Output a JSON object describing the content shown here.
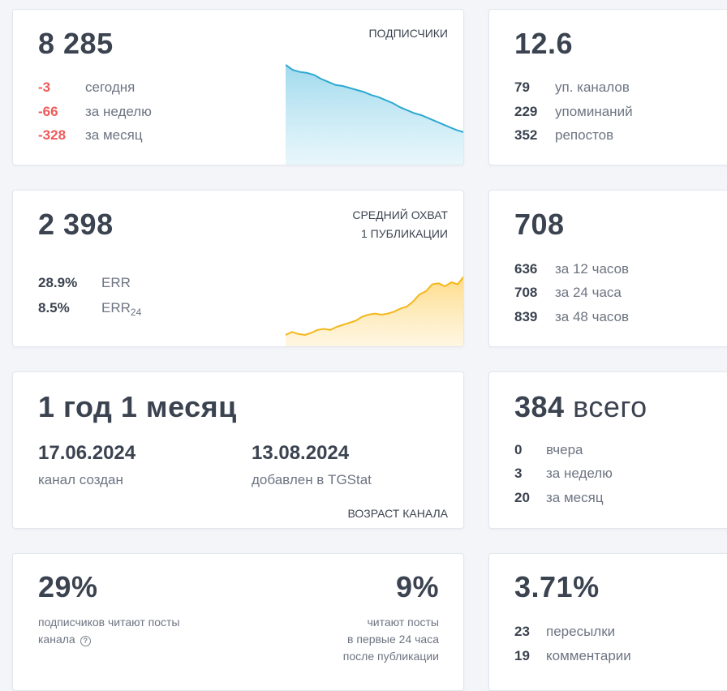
{
  "subscribers": {
    "value": "8 285",
    "caption": "ПОДПИСЧИКИ",
    "rows": [
      {
        "n": "-3",
        "label": "сегодня"
      },
      {
        "n": "-66",
        "label": "за неделю"
      },
      {
        "n": "-328",
        "label": "за месяц"
      }
    ],
    "trend": [
      1.0,
      0.95,
      0.93,
      0.92,
      0.9,
      0.86,
      0.83,
      0.8,
      0.79,
      0.77,
      0.75,
      0.73,
      0.7,
      0.68,
      0.65,
      0.62,
      0.58,
      0.55,
      0.52,
      0.5,
      0.47,
      0.44,
      0.41,
      0.38,
      0.35,
      0.33
    ],
    "color": "#2fa9d2"
  },
  "citation": {
    "value": "12.6",
    "rows": [
      {
        "n": "79",
        "label": "уп. каналов"
      },
      {
        "n": "229",
        "label": "упоминаний"
      },
      {
        "n": "352",
        "label": "репостов"
      }
    ]
  },
  "reach": {
    "value": "2 398",
    "caption_line1": "СРЕДНИЙ ОХВАТ",
    "caption_line2": "1 ПУБЛИКАЦИИ",
    "err_value": "28.9%",
    "err_label": "ERR",
    "err24_value": "8.5%",
    "err24_label": "ERR",
    "err24_sub": "24",
    "trend": [
      0.12,
      0.15,
      0.13,
      0.12,
      0.14,
      0.17,
      0.18,
      0.17,
      0.2,
      0.22,
      0.24,
      0.26,
      0.3,
      0.32,
      0.33,
      0.32,
      0.33,
      0.35,
      0.38,
      0.4,
      0.45,
      0.52,
      0.55,
      0.62,
      0.63,
      0.6,
      0.64,
      0.62,
      0.7
    ],
    "color": "#f4b71a"
  },
  "views": {
    "value": "708",
    "rows": [
      {
        "n": "636",
        "label": "за 12 часов"
      },
      {
        "n": "708",
        "label": "за 24 часа"
      },
      {
        "n": "839",
        "label": "за 48 часов"
      }
    ]
  },
  "age": {
    "value": "1 год 1 месяц",
    "created_date": "17.06.2024",
    "created_label": "канал создан",
    "added_date": "13.08.2024",
    "added_label": "добавлен в TGStat",
    "caption": "ВОЗРАСТ КАНАЛА"
  },
  "posts": {
    "value": "384",
    "value_suffix": "всего",
    "rows": [
      {
        "n": "0",
        "label": "вчера"
      },
      {
        "n": "3",
        "label": "за неделю"
      },
      {
        "n": "20",
        "label": "за месяц"
      }
    ]
  },
  "readers": {
    "left_value": "29%",
    "left_text_line1": "подписчиков читают посты",
    "left_text_line2": "канала",
    "help_icon": "?",
    "right_value": "9%",
    "right_text_line1": "читают посты",
    "right_text_line2": "в первые 24 часа",
    "right_text_line3": "после публикации"
  },
  "engagement": {
    "value": "3.71%",
    "rows": [
      {
        "n": "23",
        "label": "пересылки"
      },
      {
        "n": "19",
        "label": "комментарии"
      }
    ]
  }
}
